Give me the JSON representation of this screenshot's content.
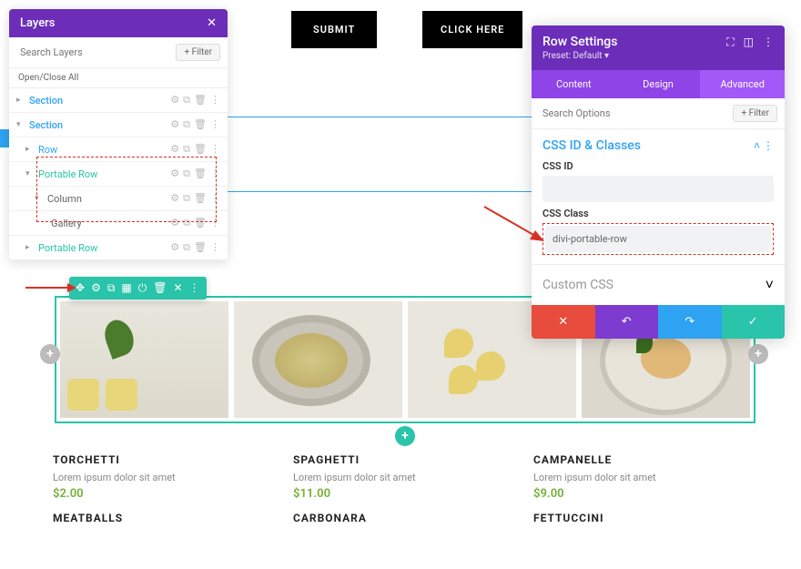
{
  "layers": {
    "title": "Layers",
    "search_placeholder": "Search Layers",
    "filter": "+ Filter",
    "open_close": "Open/Close All",
    "items": [
      {
        "label": "Section",
        "kind": "section"
      },
      {
        "label": "Section",
        "kind": "section"
      },
      {
        "label": "Row",
        "kind": "row"
      },
      {
        "label": "Portable Row",
        "kind": "prow"
      },
      {
        "label": "Column",
        "kind": "col"
      },
      {
        "label": "Gallery",
        "kind": "mod"
      },
      {
        "label": "Portable Row",
        "kind": "prow"
      }
    ]
  },
  "buttons": {
    "submit": "SUBMIT",
    "click_here": "CLICK HERE"
  },
  "settings": {
    "title": "Row Settings",
    "preset": "Preset: Default",
    "tabs": [
      "Content",
      "Design",
      "Advanced"
    ],
    "search_placeholder": "Search Options",
    "filter": "+ Filter",
    "section_css_id_classes": "CSS ID & Classes",
    "css_id_label": "CSS ID",
    "css_id_value": "",
    "css_class_label": "CSS Class",
    "css_class_value": "divi-portable-row",
    "custom_css": "Custom CSS"
  },
  "menu": [
    {
      "name": "TORCHETTI",
      "desc": "Lorem ipsum dolor sit amet",
      "price": "$2.00"
    },
    {
      "name": "SPAGHETTI",
      "desc": "Lorem ipsum dolor sit amet",
      "price": "$11.00"
    },
    {
      "name": "CAMPANELLE",
      "desc": "Lorem ipsum dolor sit amet",
      "price": "$9.00"
    },
    {
      "name": "MEATBALLS",
      "desc": "",
      "price": ""
    },
    {
      "name": "CARBONARA",
      "desc": "",
      "price": ""
    },
    {
      "name": "FETTUCCINI",
      "desc": "",
      "price": ""
    }
  ]
}
